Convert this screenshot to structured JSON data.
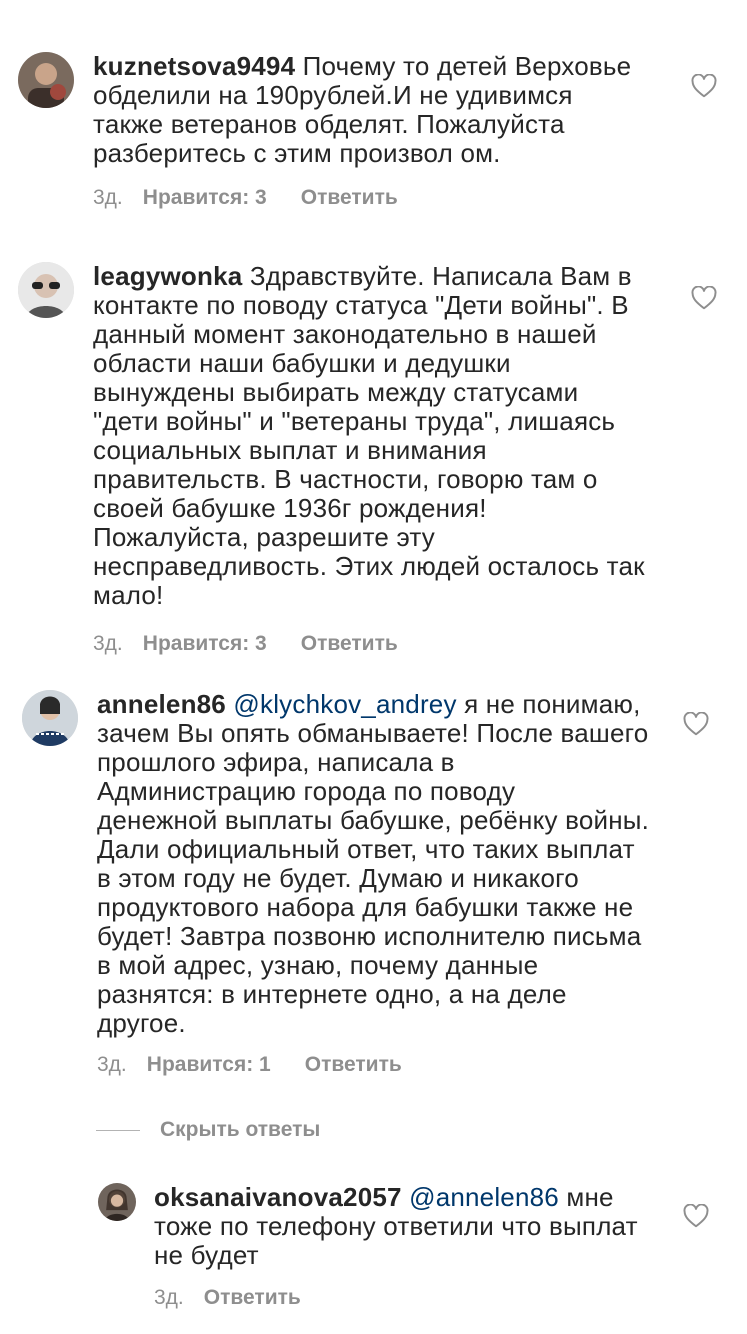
{
  "comments": [
    {
      "username": "kuznetsova9494",
      "mention": "",
      "text": " Почему то детей Верховье\nобделили на 190рублей.И не удивимся\nтакже ветеранов обделят. Пожалуйста\nразберитесь с этим произвол ом.",
      "time": "3д.",
      "likes": "Нравится: 3",
      "reply": "Ответить"
    },
    {
      "username": "leagywonka",
      "mention": "",
      "text": " Здравствуйте. Написала Вам в\nконтакте по поводу статуса \"Дети войны\". В\nданный момент законодательно в нашей\nобласти наши бабушки и дедушки\nвынуждены выбирать между статусами\n\"дети войны\" и \"ветераны труда\", лишаясь\nсоциальных выплат и внимания\nправительств. В частности, говорю там о\nсвоей бабушке 1936г рождения!\nПожалуйста, разрешите эту\nнесправедливость. Этих людей осталось так\nмало!",
      "time": "3д.",
      "likes": "Нравится: 3",
      "reply": "Ответить"
    },
    {
      "username": "annelen86",
      "mention": " @klychkov_andrey",
      "text": " я не понимаю,\nзачем Вы опять обманываете! После вашего\nпрошлого эфира, написала в\nАдминистрацию города по поводу\nденежной выплаты бабушке, ребёнку войны.\nДали официальный ответ, что таких выплат\nв этом году не будет. Думаю и никакого\nпродуктового набора для бабушки также не\nбудет! Завтра позвоню исполнителю письма\nв мой адрес, узнаю, почему данные\nразнятся: в интернете одно, а на деле\nдругое.",
      "time": "3д.",
      "likes": "Нравится: 1",
      "reply": "Ответить"
    }
  ],
  "hide_replies": "Скрыть ответы",
  "reply_comment": {
    "username": "oksanaivanova2057",
    "mention": " @annelen86",
    "text": " мне\nтоже по телефону ответили что выплат\nне будет",
    "time": "3д.",
    "reply": "Ответить"
  },
  "colors": {
    "text": "#262626",
    "meta": "#8e8e8e",
    "mention": "#00376b",
    "background": "#ffffff"
  },
  "icons": {
    "like": "heart-outline-icon"
  }
}
